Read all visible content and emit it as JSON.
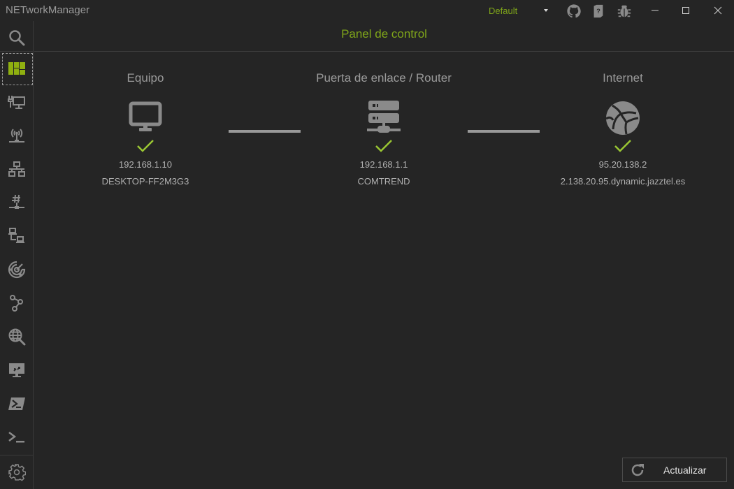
{
  "window": {
    "title": "NETworkManager",
    "profile": {
      "selected": "Default"
    },
    "toolbar_icons": [
      "github-icon",
      "help-book-icon",
      "bug-icon"
    ],
    "controls": [
      "minimize",
      "maximize",
      "close"
    ]
  },
  "colors": {
    "accent": "#7fa51a",
    "check": "#9ac733",
    "background": "#252525",
    "icon": "#8a8a8a"
  },
  "sidebar": {
    "items": [
      {
        "id": "search",
        "icon": "search-icon",
        "selected": false
      },
      {
        "id": "dashboard",
        "icon": "dashboard-icon",
        "selected": true
      },
      {
        "id": "network-interface",
        "icon": "network-interface-icon",
        "selected": false
      },
      {
        "id": "wifi",
        "icon": "wireless-icon",
        "selected": false
      },
      {
        "id": "ip-scanner",
        "icon": "network-tree-icon",
        "selected": false
      },
      {
        "id": "port-scanner",
        "icon": "hash-network-icon",
        "selected": false
      },
      {
        "id": "ping-monitor",
        "icon": "computers-icon",
        "selected": false
      },
      {
        "id": "discovery",
        "icon": "radar-icon",
        "selected": false
      },
      {
        "id": "traceroute",
        "icon": "route-icon",
        "selected": false
      },
      {
        "id": "dns-lookup",
        "icon": "globe-search-icon",
        "selected": false
      },
      {
        "id": "remote-desktop",
        "icon": "remote-desktop-icon",
        "selected": false
      },
      {
        "id": "powershell",
        "icon": "powershell-icon",
        "selected": false
      },
      {
        "id": "putty",
        "icon": "terminal-icon",
        "selected": false
      },
      {
        "id": "settings",
        "icon": "gear-icon",
        "selected": false
      }
    ]
  },
  "main": {
    "title": "Panel de control",
    "nodes": [
      {
        "title": "Equipo",
        "icon": "monitor-icon",
        "status": "ok",
        "ip": "192.168.1.10",
        "host": "DESKTOP-FF2M3G3"
      },
      {
        "title": "Puerta de enlace / Router",
        "icon": "server-icon",
        "status": "ok",
        "ip": "192.168.1.1",
        "host": "COMTREND"
      },
      {
        "title": "Internet",
        "icon": "internet-globe-icon",
        "status": "ok",
        "ip": "95.20.138.2",
        "host": "2.138.20.95.dynamic.jazztel.es"
      }
    ],
    "refresh_button": {
      "label": "Actualizar"
    }
  }
}
